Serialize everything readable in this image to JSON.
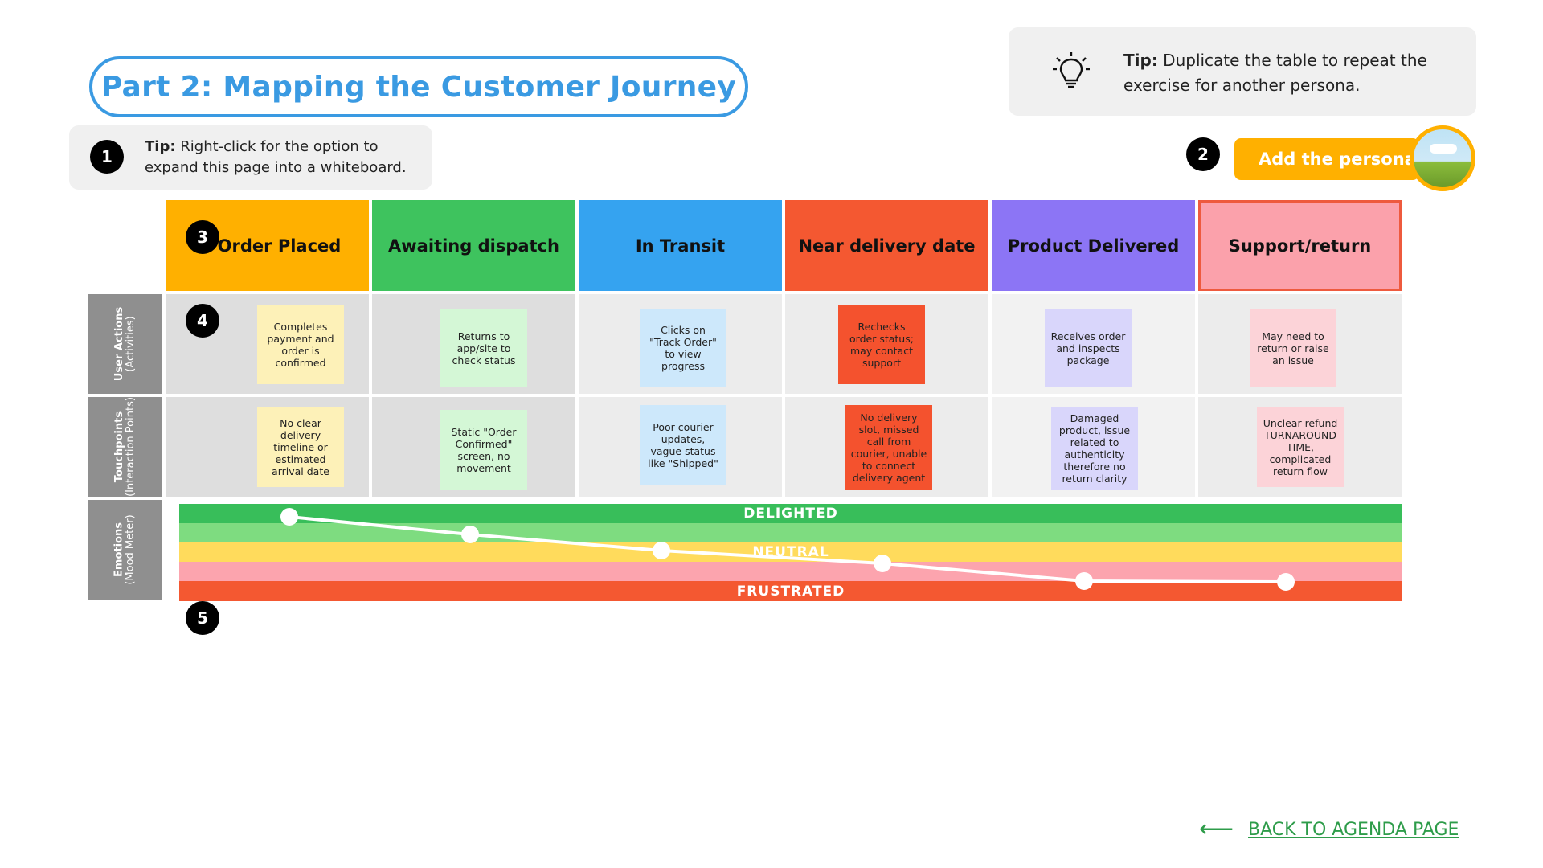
{
  "title": "Part 2: Mapping the Customer Journey",
  "tip1": {
    "label": "Tip:",
    "text": "Right-click for the option to expand this page into a whiteboard."
  },
  "tip2": {
    "label": "Tip:",
    "text": "Duplicate the table to repeat the exercise for another persona.",
    "icon": "lightbulb-icon"
  },
  "markers": [
    "1",
    "2",
    "3",
    "4",
    "5"
  ],
  "persona_button": "Add the persona",
  "stages": [
    {
      "label": "Order Placed",
      "color": "#ffb000"
    },
    {
      "label": "Awaiting dispatch",
      "color": "#3ec35e"
    },
    {
      "label": "In Transit",
      "color": "#35a3f0"
    },
    {
      "label": "Near delivery date",
      "color": "#f45831"
    },
    {
      "label": "Product Delivered",
      "color": "#8c75f5"
    },
    {
      "label": "Support/return",
      "color": "#fba1ab"
    }
  ],
  "rows": {
    "user_actions": {
      "title": "User Actions",
      "subtitle": "(Activities)"
    },
    "touchpoints": {
      "title": "Touchpoints",
      "subtitle": "(Interaction Points)"
    },
    "emotions": {
      "title": "Emotions",
      "subtitle": "(Mood Meter)"
    }
  },
  "user_actions": [
    "Completes payment and order is confirmed",
    "Returns to app/site to check status",
    "Clicks on \"Track Order\" to view progress",
    "Rechecks order status; may contact support",
    "Receives order and inspects package",
    "May need to return or raise an issue"
  ],
  "touchpoints": [
    "No clear delivery timeline or estimated arrival date",
    "Static \"Order Confirmed\" screen, no movement",
    "Poor courier updates, vague status like \"Shipped\"",
    "No delivery slot, missed call from courier, unable to connect delivery agent",
    "Damaged product, issue related to authenticity therefore no return clarity",
    "Unclear refund TURNAROUND TIME, complicated return flow"
  ],
  "note_colors": [
    "#fdf1b8",
    "#d4f7d6",
    "#cde8fb",
    "#f4522e",
    "#d9d6fb",
    "#fcd3d8"
  ],
  "emotion_bands": {
    "delighted": "DELIGHTED",
    "neutral": "NEUTRAL",
    "frustrated": "FRUSTRATED",
    "colors": [
      "#38be5a",
      "#7edc80",
      "#ffdb5c",
      "#fca4ae",
      "#f45831"
    ]
  },
  "emotion_scores": [
    0.9,
    0.7,
    0.52,
    0.38,
    0.18,
    0.17
  ],
  "back_link": "BACK TO AGENDA PAGE",
  "link_color": "#2e9c4a"
}
